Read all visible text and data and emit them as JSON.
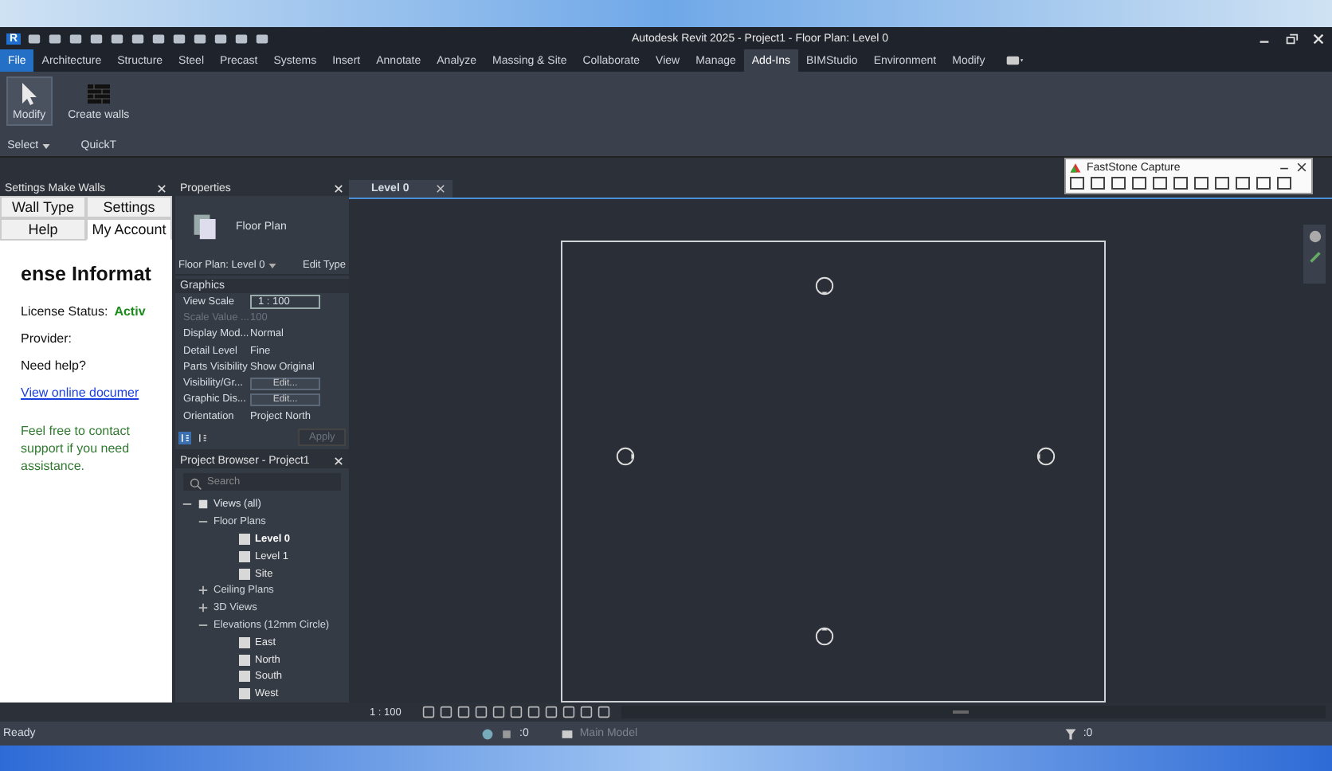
{
  "title_bar": {
    "logo": "R",
    "title": "Autodesk Revit 2025 - Project1 - Floor Plan: Level 0"
  },
  "menu_tabs": [
    {
      "label": "File",
      "kind": "file",
      "selected": false
    },
    {
      "label": "Architecture",
      "kind": "tab",
      "selected": false
    },
    {
      "label": "Structure",
      "kind": "tab",
      "selected": false
    },
    {
      "label": "Steel",
      "kind": "tab",
      "selected": false
    },
    {
      "label": "Precast",
      "kind": "tab",
      "selected": false
    },
    {
      "label": "Systems",
      "kind": "tab",
      "selected": false
    },
    {
      "label": "Insert",
      "kind": "tab",
      "selected": false
    },
    {
      "label": "Annotate",
      "kind": "tab",
      "selected": false
    },
    {
      "label": "Analyze",
      "kind": "tab",
      "selected": false
    },
    {
      "label": "Massing & Site",
      "kind": "tab",
      "selected": false
    },
    {
      "label": "Collaborate",
      "kind": "tab",
      "selected": false
    },
    {
      "label": "View",
      "kind": "tab",
      "selected": false
    },
    {
      "label": "Manage",
      "kind": "tab",
      "selected": false
    },
    {
      "label": "Add-Ins",
      "kind": "tab",
      "selected": true
    },
    {
      "label": "BIMStudio",
      "kind": "tab",
      "selected": false
    },
    {
      "label": "Environment",
      "kind": "tab",
      "selected": false
    },
    {
      "label": "Modify",
      "kind": "tab",
      "selected": false
    }
  ],
  "ribbon": {
    "panels": [
      {
        "label": "Select",
        "button": "Modify",
        "kind": "select"
      },
      {
        "label": "QuickT",
        "button": "Create walls",
        "kind": "walls"
      }
    ]
  },
  "settings_panel": {
    "title": "Settings Make Walls",
    "tabs": [
      {
        "label": "Wall Type",
        "selected": false
      },
      {
        "label": "Settings",
        "selected": false
      },
      {
        "label": "Help",
        "selected": false
      },
      {
        "label": "My Account",
        "selected": true
      }
    ],
    "heading": "ense Informat",
    "license_label": "License Status:",
    "license_value": "Activ",
    "provider_label": "Provider:",
    "help_label": "Need help?",
    "link": "View online documer",
    "support_text": "Feel free to contact support if you need assistance."
  },
  "properties": {
    "title": "Properties",
    "type_name": "Floor Plan",
    "selector": "Floor Plan: Level 0",
    "edit_type": "Edit Type",
    "group": "Graphics",
    "rows": [
      {
        "label": "View Scale",
        "value": "1 : 100",
        "kind": "field",
        "disabled": false
      },
      {
        "label": "Scale Value ...",
        "value": "100",
        "kind": "text",
        "disabled": true
      },
      {
        "label": "Display Mod...",
        "value": "Normal",
        "kind": "text",
        "disabled": false
      },
      {
        "label": "Detail Level",
        "value": "Fine",
        "kind": "text",
        "disabled": false
      },
      {
        "label": "Parts Visibility",
        "value": "Show Original",
        "kind": "text",
        "disabled": false
      },
      {
        "label": "Visibility/Gr...",
        "value": "Edit...",
        "kind": "button",
        "disabled": false
      },
      {
        "label": "Graphic Dis...",
        "value": "Edit...",
        "kind": "button",
        "disabled": false
      },
      {
        "label": "Orientation",
        "value": "Project North",
        "kind": "text",
        "disabled": false
      }
    ],
    "apply": "Apply"
  },
  "project_browser": {
    "title": "Project Browser - Project1",
    "placeholder": "Search",
    "tree": [
      {
        "label": "Views (all)",
        "kind": "root",
        "expanded": true,
        "selected": false,
        "children": [
          {
            "label": "Floor Plans",
            "kind": "group",
            "expanded": true,
            "selected": false,
            "children": [
              {
                "label": "Level 0",
                "kind": "view",
                "expanded": false,
                "selected": true
              },
              {
                "label": "Level 1",
                "kind": "view",
                "expanded": false,
                "selected": false
              },
              {
                "label": "Site",
                "kind": "view",
                "expanded": false,
                "selected": false
              }
            ]
          },
          {
            "label": "Ceiling Plans",
            "kind": "group",
            "expanded": false,
            "selected": false
          },
          {
            "label": "3D Views",
            "kind": "group",
            "expanded": false,
            "selected": false
          },
          {
            "label": "Elevations (12mm Circle)",
            "kind": "group",
            "expanded": true,
            "selected": false,
            "children": [
              {
                "label": "East",
                "kind": "view",
                "expanded": false,
                "selected": false
              },
              {
                "label": "North",
                "kind": "view",
                "expanded": false,
                "selected": false
              },
              {
                "label": "South",
                "kind": "view",
                "expanded": false,
                "selected": false
              },
              {
                "label": "West",
                "kind": "view",
                "expanded": false,
                "selected": false
              }
            ]
          }
        ]
      }
    ]
  },
  "view": {
    "tab": "Level 0",
    "scale": "1 : 100"
  },
  "faststone": {
    "title": "FastStone Capture"
  },
  "status_bar": {
    "status": "Ready",
    "worksets": ":0",
    "model": "Main Model",
    "filters": ":0"
  }
}
